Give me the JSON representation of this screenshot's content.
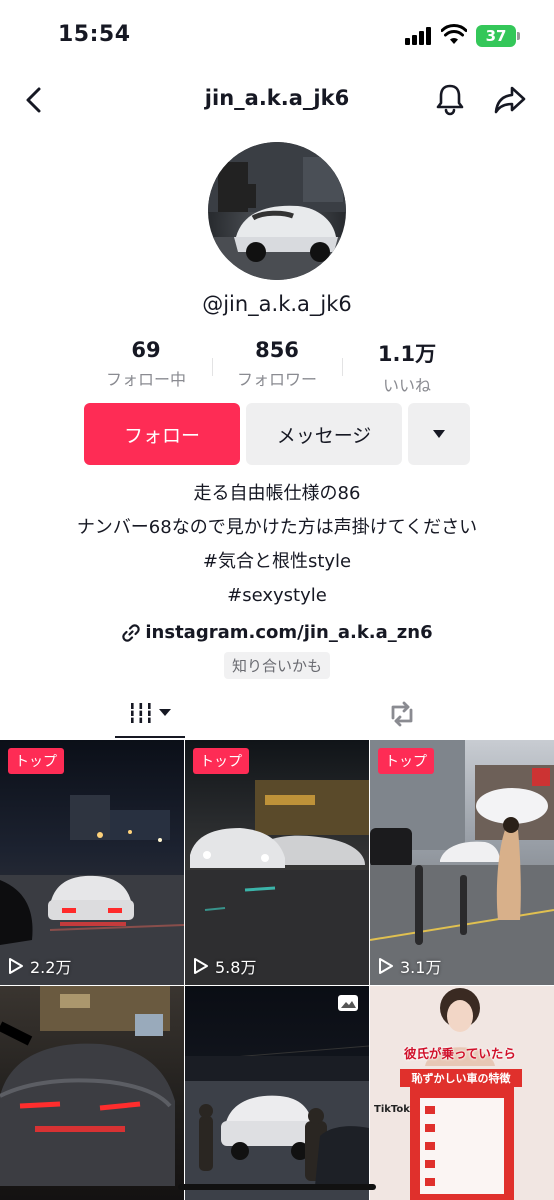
{
  "status": {
    "time": "15:54",
    "battery": "37"
  },
  "nav": {
    "title": "jin_a.k.a_jk6"
  },
  "profile": {
    "username": "@jin_a.k.a_jk6"
  },
  "stats": [
    {
      "value": "69",
      "label": "フォロー中"
    },
    {
      "value": "856",
      "label": "フォロワー"
    },
    {
      "value": "1.1万",
      "label": "いいね"
    }
  ],
  "actions": {
    "follow": "フォロー",
    "message": "メッセージ"
  },
  "bio": {
    "lines": [
      "走る自由帳仕様の86",
      "ナンバー68なので見かけた方は声掛けてください",
      "#気合と根性style",
      "#sexystyle"
    ],
    "link": "instagram.com/jin_a.k.a_zn6",
    "tag": "知り合いかも"
  },
  "videos": [
    {
      "badge": "トップ",
      "views": "2.2万"
    },
    {
      "badge": "トップ",
      "views": "5.8万"
    },
    {
      "badge": "トップ",
      "views": "3.1万"
    },
    {
      "badge": "",
      "views": ""
    },
    {
      "badge": "",
      "views": ""
    },
    {
      "badge": "",
      "views": "",
      "overlay_title": "彼氏が乗っていたら",
      "overlay_sub": "恥ずかしい車の特徴",
      "overlay_brand": "TikTok"
    }
  ],
  "colors": {
    "accent": "#fe2c55",
    "battery": "#34c759",
    "muted_text": "#8a8b91"
  }
}
